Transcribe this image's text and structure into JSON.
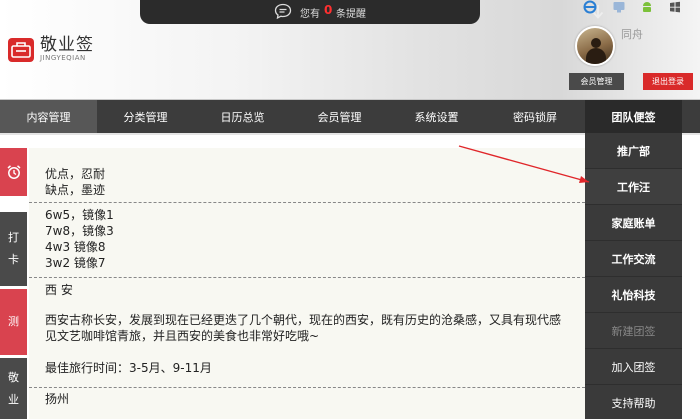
{
  "brand": {
    "name_cn": "敬业签",
    "name_en": "JINGYEQIAN",
    "color": "#d92a2a"
  },
  "notice": {
    "prefix": "您有",
    "count": "0",
    "suffix": "条提醒"
  },
  "platform_icons": [
    "ie-icon",
    "mac-icon",
    "android-icon",
    "windows-icon"
  ],
  "user": {
    "name": "同舟",
    "member_button": "会员管理",
    "logout_button": "退出登录"
  },
  "nav": {
    "items": [
      {
        "label": "内容管理",
        "active": true
      },
      {
        "label": "分类管理"
      },
      {
        "label": "日历总览"
      },
      {
        "label": "会员管理"
      },
      {
        "label": "系统设置"
      },
      {
        "label": "密码锁屏"
      },
      {
        "label": "团队便签"
      }
    ]
  },
  "sidebar": {
    "card_label_1": "打",
    "card_label_2": "卡",
    "test_label": "测",
    "jy_label_1": "敬",
    "jy_label_2": "业"
  },
  "notes": {
    "n1_line1": "优点，忍耐",
    "n1_line2": "缺点，墨迹",
    "n2_line1": "6w5，镜像1",
    "n2_line2": "7w8，镜像3",
    "n2_line3": "4w3 镜像8",
    "n2_line4": "3w2 镜像7",
    "n3_title": "西 安",
    "n3_body1": "西安古称长安，发展到现在已经更迭了几个朝代，现在的西安，既有历史的沧桑感，又具有现代感",
    "n3_body2": "见文艺咖啡馆青旅，并且西安的美食也非常好吃哦~",
    "n3_travel": "最佳旅行时间：3-5月、9-11月",
    "n4_title": "扬州"
  },
  "team_menu": {
    "items": [
      {
        "label": "推广部"
      },
      {
        "label": "工作汪"
      },
      {
        "label": "家庭账单"
      },
      {
        "label": "工作交流"
      },
      {
        "label": "礼怡科技"
      },
      {
        "label": "新建团签",
        "disabled": true
      },
      {
        "label": "加入团签"
      },
      {
        "label": "支持帮助"
      }
    ]
  },
  "colors": {
    "nav_bg": "#3c3c3c",
    "accent_red": "#d9434f",
    "menu_bg": "#3a3a3a"
  }
}
